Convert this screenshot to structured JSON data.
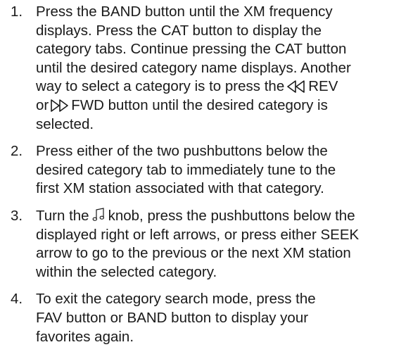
{
  "steps": [
    {
      "number": "1.",
      "line1": "Press the BAND button until the XM frequency\ndisplays. Press the CAT button to display the\ncategory tabs. Continue pressing the CAT button\nuntil the desired category name displays. Another\nway to select a category is to press the",
      "rev_label": "REV",
      "or": "or",
      "fwd_label": "FWD button until the desired category is",
      "tail": "selected.",
      "rev_icon": "rewind-icon",
      "fwd_icon": "fast-forward-icon"
    },
    {
      "number": "2.",
      "text": "Press either of the two pushbuttons below the\ndesired category tab to immediately tune to the\nfirst XM station associated with that category."
    },
    {
      "number": "3.",
      "before": "Turn the",
      "after": "knob, press the pushbuttons below the",
      "rest": "displayed right or left arrows, or press either SEEK\narrow to go to the previous or the next XM station\nwithin the selected category.",
      "icon": "music-note-icon"
    },
    {
      "number": "4.",
      "text": "To exit the category search mode, press the\nFAV button or BAND button to display your\nfavorites again."
    }
  ]
}
